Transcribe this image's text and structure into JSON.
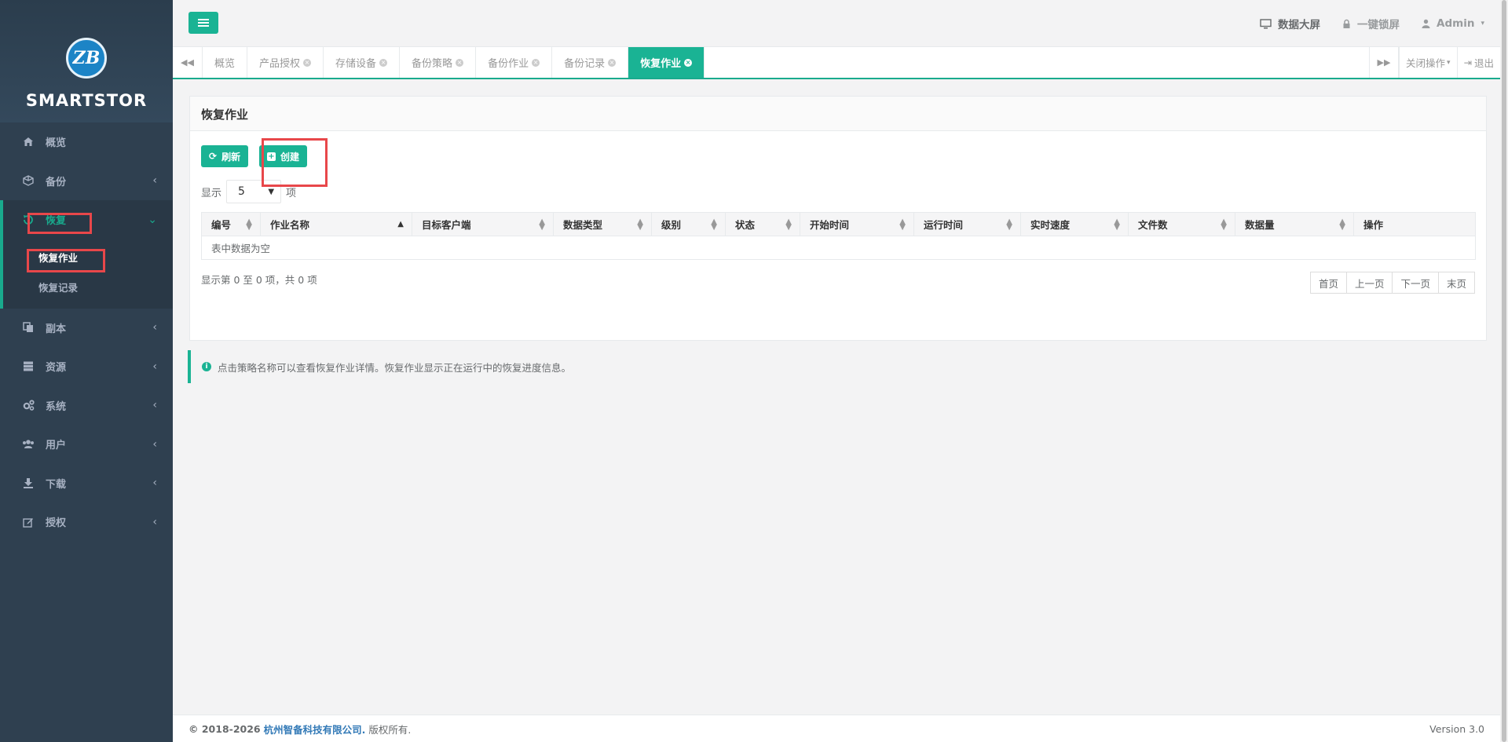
{
  "sidebar": {
    "logo_text": "ZB",
    "brand": "SMARTSTOR",
    "items": [
      {
        "label": "概览",
        "icon": "home-icon"
      },
      {
        "label": "备份",
        "icon": "cube-icon"
      },
      {
        "label": "恢复",
        "icon": "restore-icon"
      },
      {
        "label": "副本",
        "icon": "copy-icon"
      },
      {
        "label": "资源",
        "icon": "server-icon"
      },
      {
        "label": "系统",
        "icon": "gears-icon"
      },
      {
        "label": "用户",
        "icon": "users-icon"
      },
      {
        "label": "下载",
        "icon": "download-icon"
      },
      {
        "label": "授权",
        "icon": "edit-icon"
      }
    ],
    "sub_items": [
      {
        "label": "恢复作业"
      },
      {
        "label": "恢复记录"
      }
    ]
  },
  "topbar": {
    "data_screen": "数据大屏",
    "lock_screen": "一键锁屏",
    "user": "Admin"
  },
  "tabs": {
    "items": [
      "概览",
      "产品授权",
      "存储设备",
      "备份策略",
      "备份作业",
      "备份记录",
      "恢复作业"
    ],
    "close_ops": "关闭操作",
    "logout": "退出"
  },
  "panel": {
    "title": "恢复作业",
    "refresh_label": "刷新",
    "create_label": "创建",
    "show_prefix": "显示",
    "page_size": "5",
    "show_suffix": "项",
    "columns": [
      "编号",
      "作业名称",
      "目标客户端",
      "数据类型",
      "级别",
      "状态",
      "开始时间",
      "运行时间",
      "实时速度",
      "文件数",
      "数据量",
      "操作"
    ],
    "empty_text": "表中数据为空",
    "info_text": "显示第 0 至 0 项，共 0 项",
    "pager": [
      "首页",
      "上一页",
      "下一页",
      "末页"
    ]
  },
  "notice": "点击策略名称可以查看恢复作业详情。恢复作业显示正在运行中的恢复进度信息。",
  "footer": {
    "copyright": "© 2018-2026",
    "company": "杭州智备科技有限公司.",
    "rights": "版权所有.",
    "version": "Version 3.0"
  },
  "colors": {
    "accent": "#1ab394",
    "sidebar_bg": "#2f4050",
    "annotation_red": "#e8474a"
  }
}
